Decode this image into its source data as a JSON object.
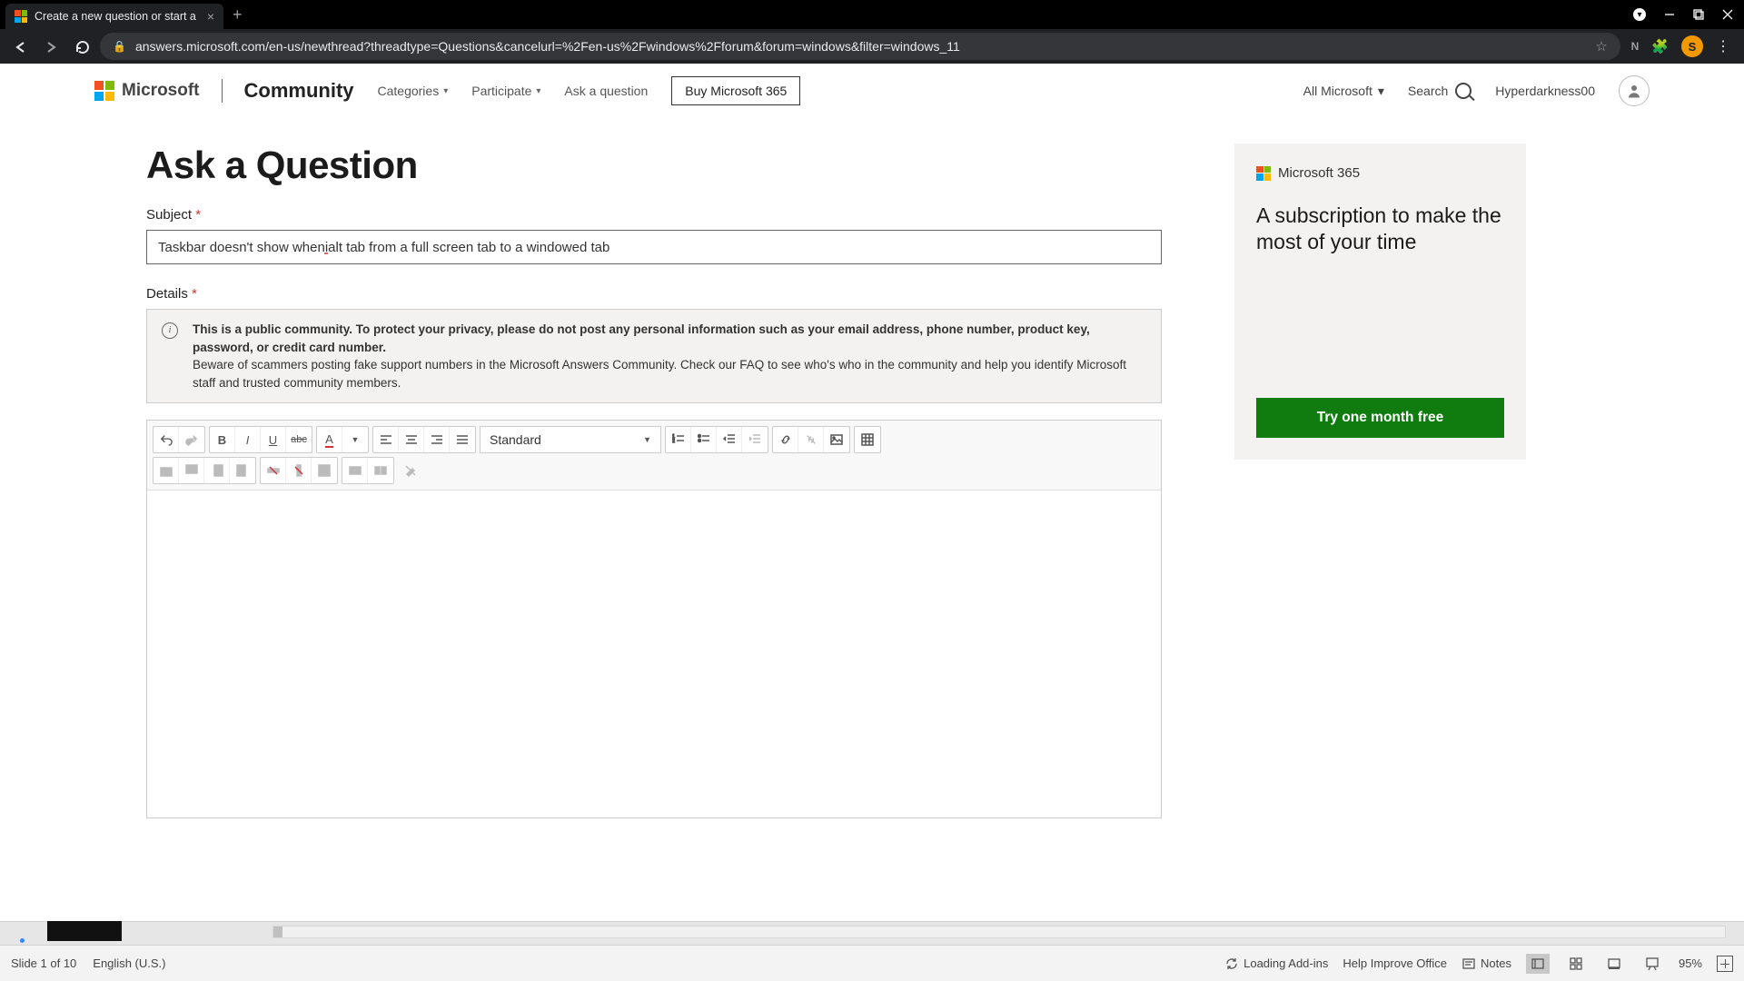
{
  "browser": {
    "tab_title": "Create a new question or start a ",
    "url": "answers.microsoft.com/en-us/newthread?threadtype=Questions&cancelurl=%2Fen-us%2Fwindows%2Fforum&forum=windows&filter=windows_11",
    "profile_initial": "S",
    "ext_badge": "N"
  },
  "header": {
    "brand": "Microsoft",
    "community": "Community",
    "nav": {
      "categories": "Categories",
      "participate": "Participate",
      "ask": "Ask a question",
      "buy": "Buy Microsoft 365",
      "all_ms": "All Microsoft",
      "search": "Search",
      "username": "Hyperdarkness00"
    }
  },
  "page": {
    "title": "Ask a Question",
    "subject_label": "Subject",
    "subject_value_pre": "Taskbar doesn't show when ",
    "subject_value_mark": "i",
    "subject_value_post": " alt tab from a full screen tab to a windowed tab",
    "details_label": "Details",
    "notice_bold": "This is a public community. To protect your privacy, please do not post any personal information such as your email address, phone number, product key, password, or credit card number.",
    "notice_rest": "Beware of scammers posting fake support numbers in the Microsoft Answers Community.  Check our FAQ to see who's who in the community and help you identify Microsoft staff and trusted community members.",
    "font_style": "Standard"
  },
  "sidebar": {
    "product": "Microsoft 365",
    "headline": "A subscription to make the most of your time",
    "cta": "Try one month free"
  },
  "statusbar": {
    "slide": "Slide 1 of 10",
    "lang": "English (U.S.)",
    "loading": "Loading Add-ins",
    "help": "Help Improve Office",
    "notes": "Notes",
    "zoom": "95%"
  }
}
